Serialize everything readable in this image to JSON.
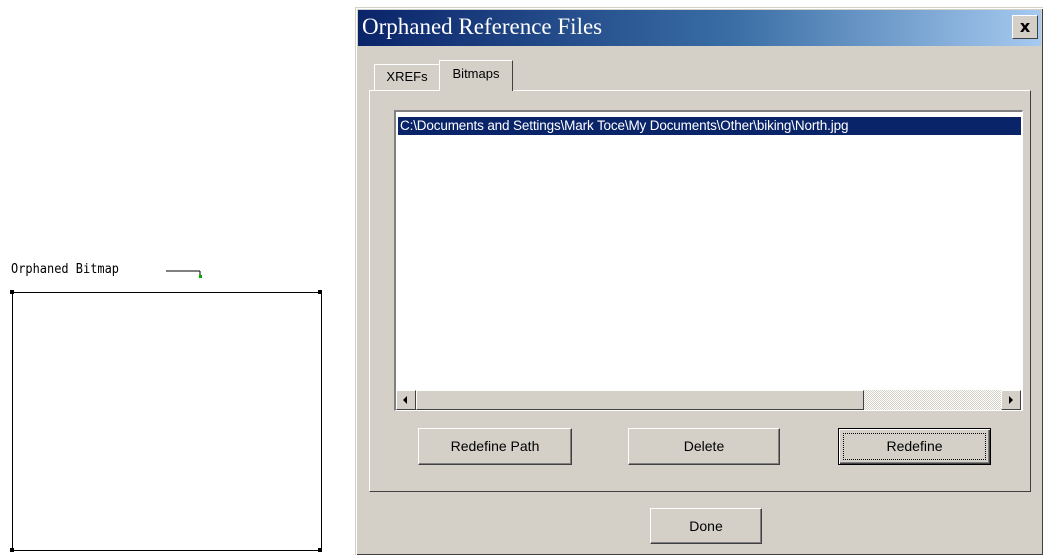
{
  "canvas": {
    "label": "Orphaned Bitmap"
  },
  "dialog": {
    "title": "Orphaned Reference Files",
    "close_label": "x",
    "tabs": [
      {
        "label": "XREFs",
        "selected": false
      },
      {
        "label": "Bitmaps",
        "selected": true
      }
    ],
    "list": {
      "items": [
        {
          "path": "C:\\Documents and Settings\\Mark Toce\\My Documents\\Other\\biking\\North.jpg",
          "selected": true
        }
      ]
    },
    "buttons": {
      "redefine_path": "Redefine Path",
      "delete": "Delete",
      "redefine": "Redefine",
      "done": "Done"
    }
  },
  "colors": {
    "title_gradient_start": "#0a246a",
    "title_gradient_end": "#a6caf0",
    "selection": "#0a246a",
    "face": "#d4d0c8",
    "leader_grip": "#00aa00"
  }
}
